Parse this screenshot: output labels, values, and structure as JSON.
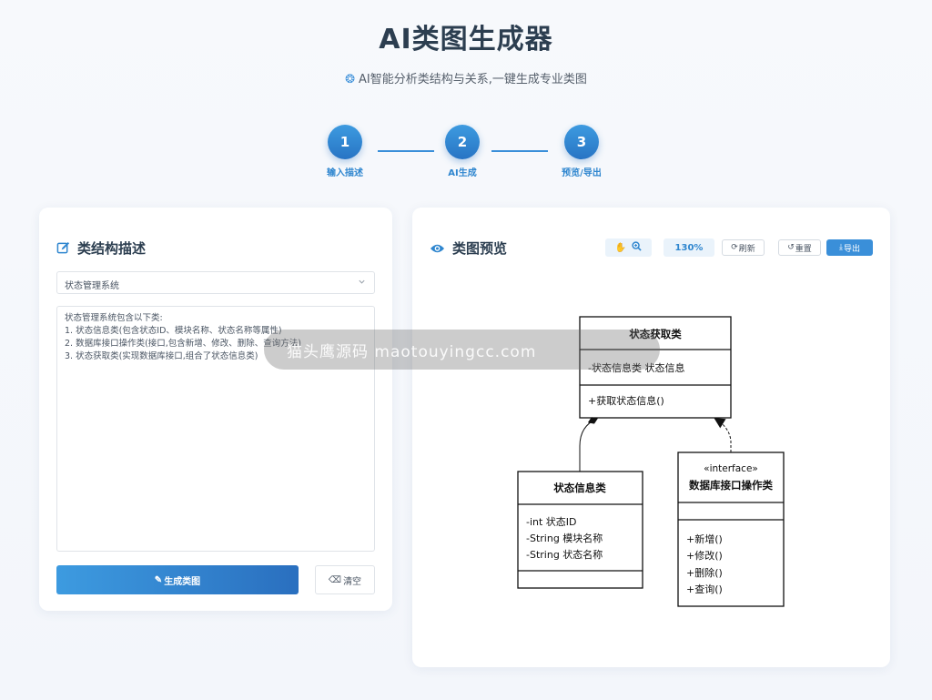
{
  "header": {
    "title": "AI类图生成器",
    "subtitle": "AI智能分析类结构与关系,一键生成专业类图"
  },
  "stepper": [
    {
      "number": "1",
      "label": "输入描述"
    },
    {
      "number": "2",
      "label": "AI生成"
    },
    {
      "number": "3",
      "label": "预览/导出"
    }
  ],
  "left_panel": {
    "title": "类结构描述",
    "select_value": "状态管理系统",
    "textarea_value": "状态管理系统包含以下类:\n1. 状态信息类(包含状态ID、模块名称、状态名称等属性)\n2. 数据库接口操作类(接口,包含新增、修改、删除、查询方法)\n3. 状态获取类(实现数据库接口,组合了状态信息类)",
    "generate_label": "生成类图",
    "clear_label": "清空"
  },
  "right_panel": {
    "title": "类图预览",
    "zoom": "130%",
    "refresh_label": "刷新",
    "reset_label": "重置",
    "export_label": "导出"
  },
  "diagram": {
    "class_getter": {
      "name": "状态获取类",
      "attributes": [
        "-状态信息类 状态信息"
      ],
      "methods": [
        "+获取状态信息()"
      ]
    },
    "class_info": {
      "name": "状态信息类",
      "attributes": [
        "-int 状态ID",
        "-String 模块名称",
        "-String 状态名称"
      ],
      "methods": []
    },
    "class_db": {
      "stereotype": "«interface»",
      "name": "数据库接口操作类",
      "attributes": [],
      "methods": [
        "+新增()",
        "+修改()",
        "+删除()",
        "+查询()"
      ]
    }
  },
  "watermark": "猫头鹰源码 maotouyingcc.com",
  "colors": {
    "accent": "#3a8fd9",
    "title": "#2c3e50"
  }
}
